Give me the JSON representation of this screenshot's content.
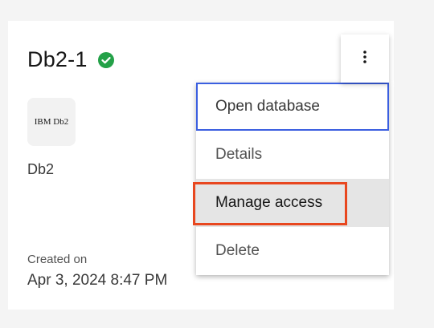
{
  "card": {
    "title": "Db2-1",
    "status_icon": "checkmark-filled-icon",
    "status_color": "#24a148",
    "logo_text": "IBM Db2",
    "service_type": "Db2",
    "created_label": "Created on",
    "created_value": "Apr 3, 2024 8:47 PM"
  },
  "overflow_menu": {
    "icon": "overflow-menu-vertical-icon",
    "items": [
      {
        "label": "Open database",
        "state": "focused"
      },
      {
        "label": "Details",
        "state": "default"
      },
      {
        "label": "Manage access",
        "state": "hovered"
      },
      {
        "label": "Delete",
        "state": "default"
      }
    ]
  },
  "colors": {
    "focus_outline": "#3b5fe0",
    "annotation_outline": "#e8471f",
    "hover_background": "#e5e5e5"
  }
}
